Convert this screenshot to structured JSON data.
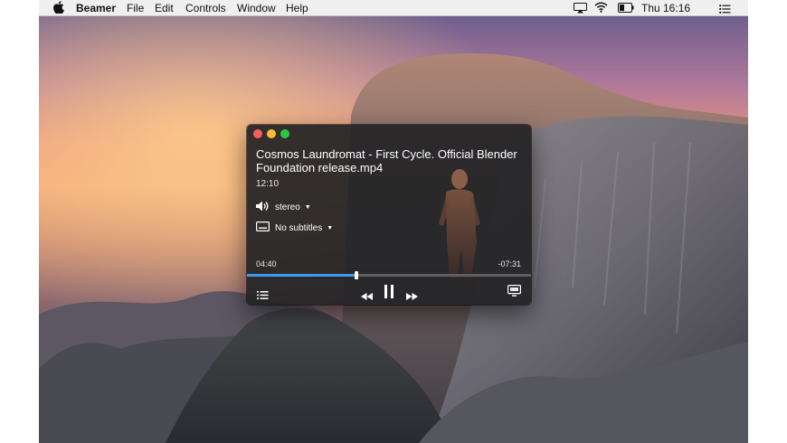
{
  "menubar": {
    "app_name": "Beamer",
    "items": [
      "File",
      "Edit",
      "Controls",
      "Window",
      "Help"
    ],
    "clock": "Thu 16:16",
    "icons": [
      "apple-icon",
      "airplay-icon",
      "wifi-icon",
      "battery-icon",
      "notification-center-icon"
    ]
  },
  "player": {
    "title": "Cosmos Laundromat - First Cycle. Official Blender Foundation release.mp4",
    "duration": "12:10",
    "audio_track": "stereo",
    "subtitles": "No subtitles",
    "elapsed": "04:40",
    "remaining": "-07:31",
    "progress": 0.384,
    "accent_color": "#3b9bf2",
    "icons": [
      "speaker-icon",
      "subtitles-icon",
      "playlist-icon",
      "rewind-icon",
      "pause-icon",
      "fast-forward-icon",
      "airplay-screen-icon"
    ]
  }
}
